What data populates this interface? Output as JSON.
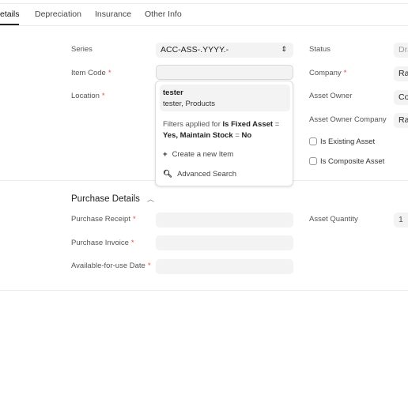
{
  "tabs": [
    {
      "label": "etails",
      "active": true
    },
    {
      "label": "Depreciation"
    },
    {
      "label": "Insurance"
    },
    {
      "label": "Other Info"
    }
  ],
  "details": {
    "series": {
      "label": "Series",
      "value": "ACC-ASS-.YYYY.-"
    },
    "item_code": {
      "label": "Item Code",
      "value": ""
    },
    "location": {
      "label": "Location"
    },
    "status": {
      "label": "Status",
      "value": "Dra"
    },
    "company": {
      "label": "Company",
      "value": "Ra"
    },
    "asset_owner": {
      "label": "Asset Owner",
      "value": "Co"
    },
    "asset_owner_company": {
      "label": "Asset Owner Company",
      "value": "Ra"
    },
    "is_existing_asset": {
      "label": "Is Existing Asset",
      "checked": false
    },
    "is_composite_asset": {
      "label": "Is Composite Asset",
      "checked": false
    }
  },
  "dropdown": {
    "result": {
      "title": "tester",
      "subtitle": "tester, Products"
    },
    "filters": {
      "prefix": "Filters applied for ",
      "f1": "Is Fixed Asset",
      "eq1": " = ",
      "v1": "Yes, Maintain Stock",
      "eq2": " = ",
      "v2": "No"
    },
    "create_label": "Create a new Item",
    "advanced_label": "Advanced Search"
  },
  "purchase": {
    "title": "Purchase Details",
    "receipt": {
      "label": "Purchase Receipt",
      "value": ""
    },
    "invoice": {
      "label": "Purchase Invoice",
      "value": ""
    },
    "date": {
      "label": "Available-for-use Date",
      "value": ""
    },
    "quantity": {
      "label": "Asset Quantity",
      "value": "1"
    }
  },
  "required_mark": "*",
  "colors": {
    "required": "#e24c4c",
    "input_bg": "#f3f3f3"
  }
}
